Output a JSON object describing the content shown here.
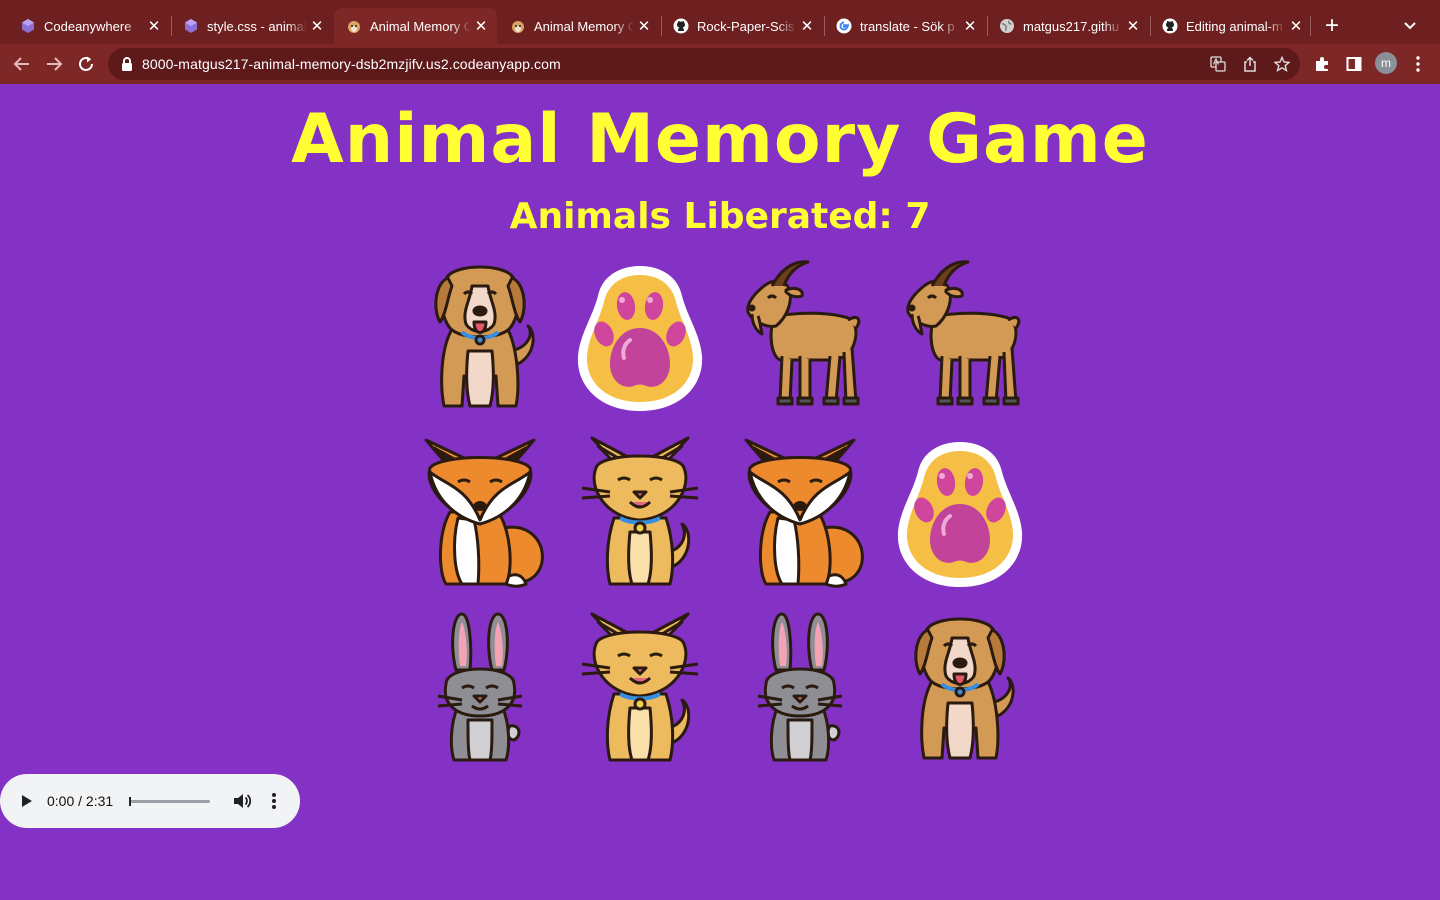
{
  "browser": {
    "tabs": [
      {
        "title": "Codeanywhere",
        "favicon": "codeanywhere-icon",
        "active": false
      },
      {
        "title": "style.css - animal",
        "favicon": "codeanywhere-icon",
        "active": false
      },
      {
        "title": "Animal Memory G",
        "favicon": "dog-icon",
        "active": true
      },
      {
        "title": "Animal Memory G",
        "favicon": "dog-icon",
        "active": false
      },
      {
        "title": "Rock-Paper-Scis",
        "favicon": "github-icon",
        "active": false
      },
      {
        "title": "translate - Sök p",
        "favicon": "google-icon",
        "active": false
      },
      {
        "title": "matgus217.githu",
        "favicon": "globe-icon",
        "active": false
      },
      {
        "title": "Editing animal-m",
        "favicon": "github-icon",
        "active": false
      }
    ],
    "url": "8000-matgus217-animal-memory-dsb2mzjifv.us2.codeanyapp.com",
    "profile_initial": "m"
  },
  "page": {
    "title": "Animal Memory Game",
    "liberated_label": "Animals Liberated: 7"
  },
  "board": [
    {
      "row": 1,
      "col": 1,
      "card": "dog"
    },
    {
      "row": 1,
      "col": 2,
      "card": "paw"
    },
    {
      "row": 1,
      "col": 3,
      "card": "goat"
    },
    {
      "row": 1,
      "col": 4,
      "card": "goat"
    },
    {
      "row": 2,
      "col": 1,
      "card": "fox"
    },
    {
      "row": 2,
      "col": 2,
      "card": "cat"
    },
    {
      "row": 2,
      "col": 3,
      "card": "fox"
    },
    {
      "row": 2,
      "col": 4,
      "card": "paw"
    },
    {
      "row": 3,
      "col": 1,
      "card": "rabbit"
    },
    {
      "row": 3,
      "col": 2,
      "card": "cat"
    },
    {
      "row": 3,
      "col": 3,
      "card": "rabbit"
    },
    {
      "row": 3,
      "col": 4,
      "card": "dog"
    }
  ],
  "audio": {
    "time": "0:00 / 2:31",
    "progress": 0
  },
  "colors": {
    "background": "#8431c6",
    "heading": "#ffff33",
    "tabstrip": "#6e1f1f",
    "toolbar": "#7d2727"
  }
}
